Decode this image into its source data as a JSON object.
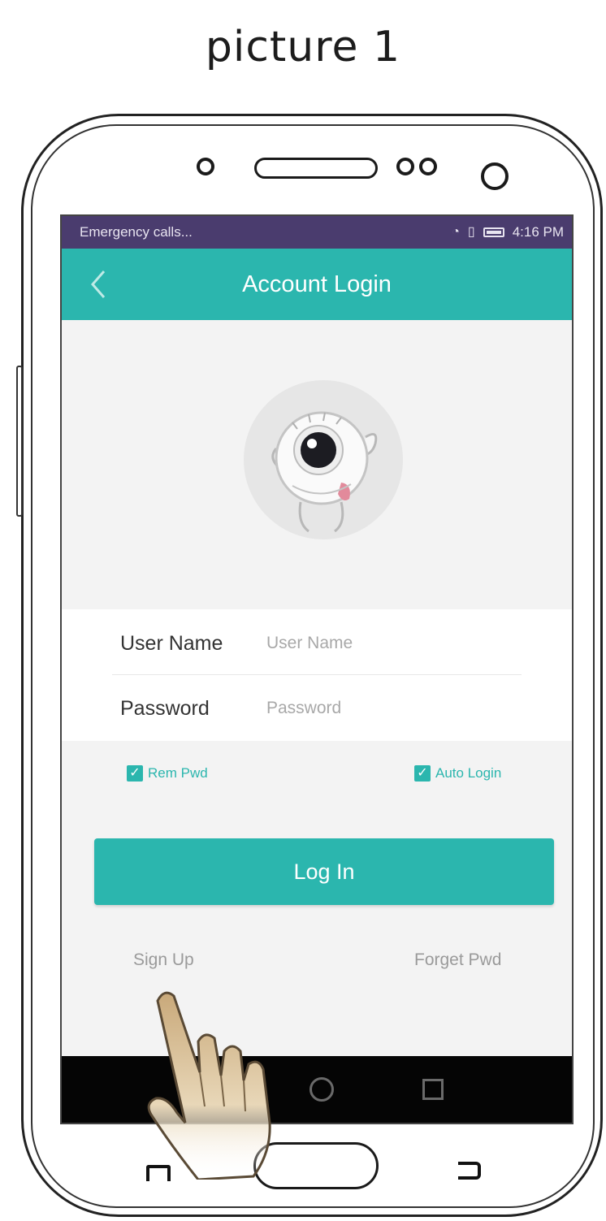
{
  "caption": "picture 1",
  "status_bar": {
    "left_text": "Emergency calls...",
    "time": "4:16 PM"
  },
  "app_bar": {
    "title": "Account Login"
  },
  "form": {
    "username_label": "User Name",
    "username_placeholder": "User Name",
    "password_label": "Password",
    "password_placeholder": "Password"
  },
  "options": {
    "remember_label": "Rem Pwd",
    "remember_checked": true,
    "auto_login_label": "Auto Login",
    "auto_login_checked": true
  },
  "buttons": {
    "login_label": "Log In",
    "sign_up_label": "Sign Up",
    "forget_label": "Forget Pwd"
  },
  "colors": {
    "accent": "#2bb6ae",
    "status_bar": "#4a3c6e",
    "nav_bar": "#050505"
  },
  "icons": {
    "back": "chevron-left-icon",
    "avatar": "eyeball-mascot-icon",
    "pointer": "hand-pointer-icon"
  }
}
